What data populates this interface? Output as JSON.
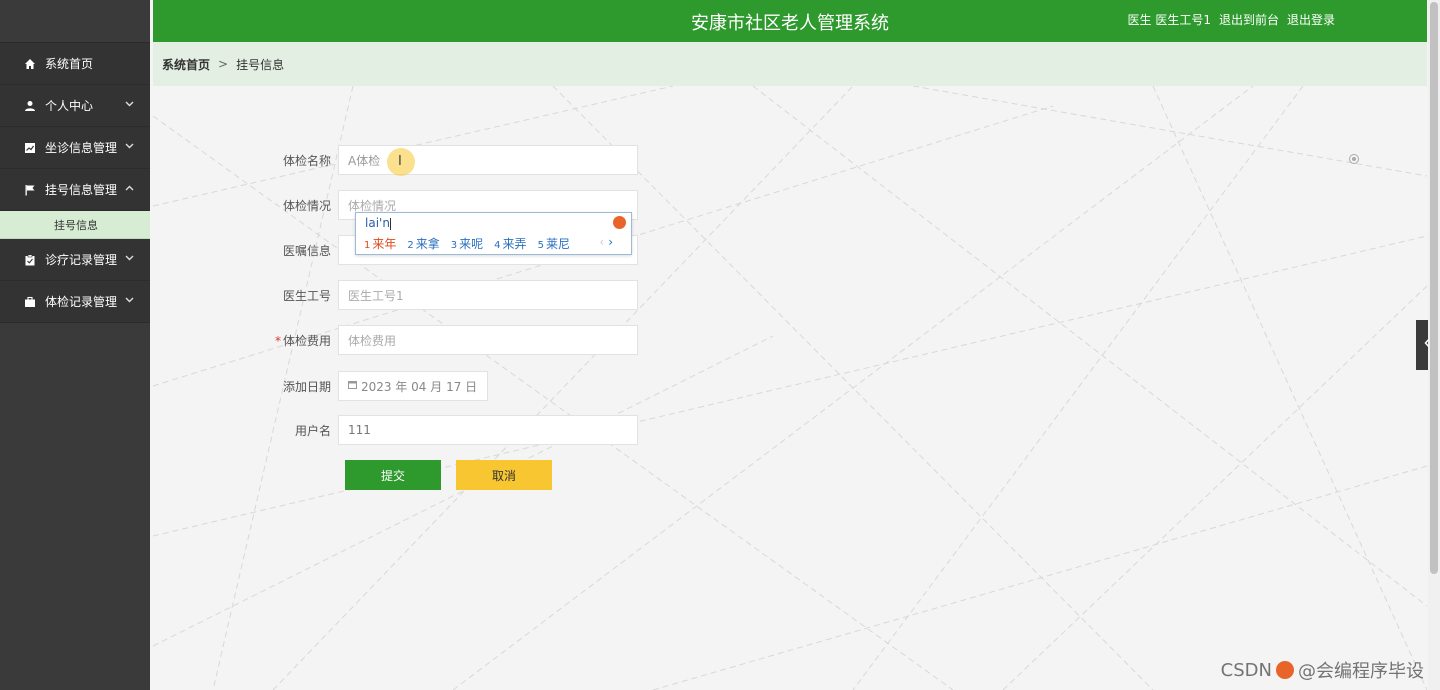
{
  "header": {
    "title": "安康市社区老人管理系统",
    "user_label": "医生 医生工号1",
    "to_front": "退出到前台",
    "logout": "退出登录"
  },
  "sidebar": {
    "items": [
      {
        "label": "系统首页",
        "icon": "home-icon"
      },
      {
        "label": "个人中心",
        "icon": "user-icon"
      },
      {
        "label": "坐诊信息管理",
        "icon": "chart-icon"
      },
      {
        "label": "挂号信息管理",
        "icon": "flag-icon"
      },
      {
        "label": "诊疗记录管理",
        "icon": "clipboard-icon"
      },
      {
        "label": "体检记录管理",
        "icon": "briefcase-icon"
      }
    ],
    "sub_active": "挂号信息"
  },
  "breadcrumb": {
    "home": "系统首页",
    "separator": ">",
    "current": "挂号信息"
  },
  "form": {
    "fields": [
      {
        "label": "体检名称",
        "value": "A体检",
        "placeholder": ""
      },
      {
        "label": "体检情况",
        "value": "",
        "placeholder": "体检情况"
      },
      {
        "label": "医嘱信息",
        "value": "",
        "placeholder": ""
      },
      {
        "label": "医生工号",
        "value": "",
        "placeholder": "医生工号1"
      },
      {
        "label": "体检费用",
        "value": "",
        "placeholder": "体检费用",
        "required": "*"
      },
      {
        "label": "添加日期",
        "value": "2023 年 04 月 17 日",
        "placeholder": ""
      },
      {
        "label": "用户名",
        "value": "111",
        "placeholder": ""
      }
    ],
    "submit": "提交",
    "cancel": "取消"
  },
  "ime": {
    "composition": "lai'n",
    "candidates": [
      {
        "num": "1",
        "text": "来年"
      },
      {
        "num": "2",
        "text": "来拿"
      },
      {
        "num": "3",
        "text": "来呢"
      },
      {
        "num": "4",
        "text": "来弄"
      },
      {
        "num": "5",
        "text": "莱尼"
      }
    ],
    "prev": "‹",
    "next": "›"
  },
  "watermark": {
    "left": "CSDN",
    "right": "@会编程序毕设"
  },
  "colors": {
    "primary": "#2e9a2e",
    "cancel": "#f7c630",
    "sidebar": "#3a3a3a",
    "breadcrumb_bg": "#e3efe2"
  }
}
